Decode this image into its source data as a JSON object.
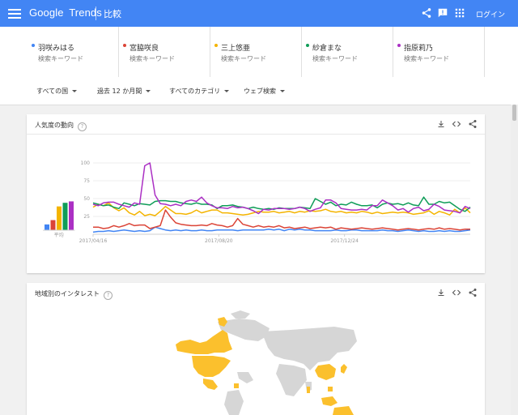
{
  "header": {
    "logo_google": "Google",
    "logo_trends": "Trends",
    "title": "比較",
    "login_label": "ログイン",
    "icons": [
      "share-icon",
      "feedback-icon",
      "apps-icon"
    ]
  },
  "terms": [
    {
      "name": "羽咲みはる",
      "subtitle": "検索キーワード",
      "color": "#4285f4"
    },
    {
      "name": "宮脇咲良",
      "subtitle": "検索キーワード",
      "color": "#db4437"
    },
    {
      "name": "三上悠亜",
      "subtitle": "検索キーワード",
      "color": "#f4b400"
    },
    {
      "name": "紗倉まな",
      "subtitle": "検索キーワード",
      "color": "#0f9d58"
    },
    {
      "name": "指原莉乃",
      "subtitle": "検索キーワード",
      "color": "#ab30c4"
    }
  ],
  "filters": [
    {
      "label": "すべての国"
    },
    {
      "label": "過去 12 か月間"
    },
    {
      "label": "すべてのカテゴリ"
    },
    {
      "label": "ウェブ検索"
    }
  ],
  "interest_card": {
    "title": "人気度の動向",
    "average_label": "平均",
    "icons": [
      "download-icon",
      "embed-icon",
      "share-icon"
    ]
  },
  "region_card": {
    "title": "地域別のインタレスト",
    "icons": [
      "download-icon",
      "embed-icon",
      "share-icon"
    ],
    "highlight_color": "#fbc02d",
    "land_color": "#d6d6d6"
  },
  "chart_data": {
    "type": "line",
    "x_tick_labels": [
      "2017/04/16",
      "2017/08/20",
      "2017/12/24"
    ],
    "y_tick_labels": [
      "100",
      "75",
      "50",
      "25"
    ],
    "ylim": [
      0,
      100
    ],
    "grid": true,
    "averages": [
      {
        "series": "羽咲みはる",
        "value": 8
      },
      {
        "series": "宮脇咲良",
        "value": 14
      },
      {
        "series": "三上悠亜",
        "value": 33
      },
      {
        "series": "紗倉まな",
        "value": 38
      },
      {
        "series": "指原莉乃",
        "value": 40
      }
    ],
    "series": [
      {
        "name": "羽咲みはる",
        "color": "#4285f4",
        "values": [
          3,
          4,
          4,
          5,
          4,
          5,
          6,
          5,
          4,
          5,
          4,
          5,
          10,
          8,
          6,
          5,
          6,
          5,
          6,
          5,
          5,
          6,
          5,
          5,
          6,
          6,
          6,
          6,
          5,
          6,
          6,
          6,
          6,
          6,
          7,
          6,
          7,
          5,
          7,
          6,
          7,
          6,
          6,
          5,
          5,
          5,
          5,
          6,
          5,
          5,
          6,
          6,
          5,
          5,
          5,
          5,
          6,
          5,
          5,
          4,
          5,
          6,
          5,
          4,
          5,
          4,
          4,
          5,
          4,
          5,
          4,
          4,
          5,
          6
        ]
      },
      {
        "name": "宮脇咲良",
        "color": "#db4437",
        "values": [
          10,
          10,
          8,
          9,
          12,
          10,
          12,
          15,
          12,
          13,
          13,
          8,
          10,
          12,
          34,
          24,
          16,
          14,
          13,
          12,
          12,
          13,
          12,
          15,
          13,
          12,
          10,
          12,
          22,
          14,
          12,
          10,
          12,
          10,
          11,
          10,
          12,
          9,
          10,
          8,
          9,
          10,
          8,
          9,
          10,
          9,
          10,
          7,
          9,
          8,
          7,
          8,
          9,
          8,
          7,
          8,
          9,
          8,
          7,
          6,
          7,
          8,
          7,
          6,
          7,
          8,
          7,
          9,
          7,
          8,
          7,
          6,
          7,
          7
        ]
      },
      {
        "name": "三上悠亜",
        "color": "#f4b400",
        "values": [
          38,
          42,
          40,
          44,
          37,
          33,
          37,
          30,
          27,
          32,
          26,
          28,
          26,
          32,
          39,
          34,
          29,
          29,
          28,
          30,
          34,
          30,
          32,
          34,
          34,
          30,
          30,
          29,
          28,
          27,
          28,
          30,
          32,
          31,
          31,
          32,
          30,
          31,
          32,
          30,
          32,
          31,
          33,
          32,
          33,
          35,
          32,
          31,
          32,
          30,
          31,
          30,
          32,
          31,
          29,
          31,
          29,
          30,
          31,
          30,
          31,
          30,
          28,
          29,
          30,
          33,
          28,
          32,
          30,
          27,
          35,
          30,
          37,
          30
        ]
      },
      {
        "name": "紗倉まな",
        "color": "#0f9d58",
        "values": [
          44,
          42,
          40,
          41,
          38,
          36,
          44,
          42,
          40,
          43,
          42,
          41,
          46,
          47,
          47,
          46,
          46,
          44,
          43,
          42,
          44,
          42,
          42,
          41,
          36,
          40,
          40,
          41,
          39,
          38,
          36,
          38,
          36,
          35,
          36,
          35,
          37,
          36,
          36,
          36,
          38,
          37,
          36,
          50,
          46,
          42,
          45,
          40,
          42,
          41,
          45,
          42,
          40,
          40,
          41,
          37,
          42,
          44,
          42,
          43,
          41,
          44,
          41,
          40,
          52,
          42,
          42,
          46,
          44,
          45,
          40,
          35,
          32,
          38
        ]
      },
      {
        "name": "指原莉乃",
        "color": "#ab30c4",
        "values": [
          42,
          40,
          44,
          45,
          45,
          42,
          40,
          38,
          44,
          42,
          96,
          100,
          55,
          43,
          42,
          40,
          42,
          40,
          46,
          48,
          46,
          52,
          44,
          40,
          37,
          37,
          36,
          39,
          37,
          38,
          36,
          33,
          29,
          35,
          34,
          36,
          36,
          36,
          35,
          36,
          38,
          36,
          32,
          35,
          37,
          48,
          48,
          44,
          36,
          35,
          34,
          34,
          35,
          34,
          40,
          40,
          48,
          44,
          40,
          34,
          36,
          31,
          36,
          38,
          33,
          35,
          42,
          39,
          34,
          33,
          32,
          30,
          39,
          36
        ]
      }
    ]
  }
}
